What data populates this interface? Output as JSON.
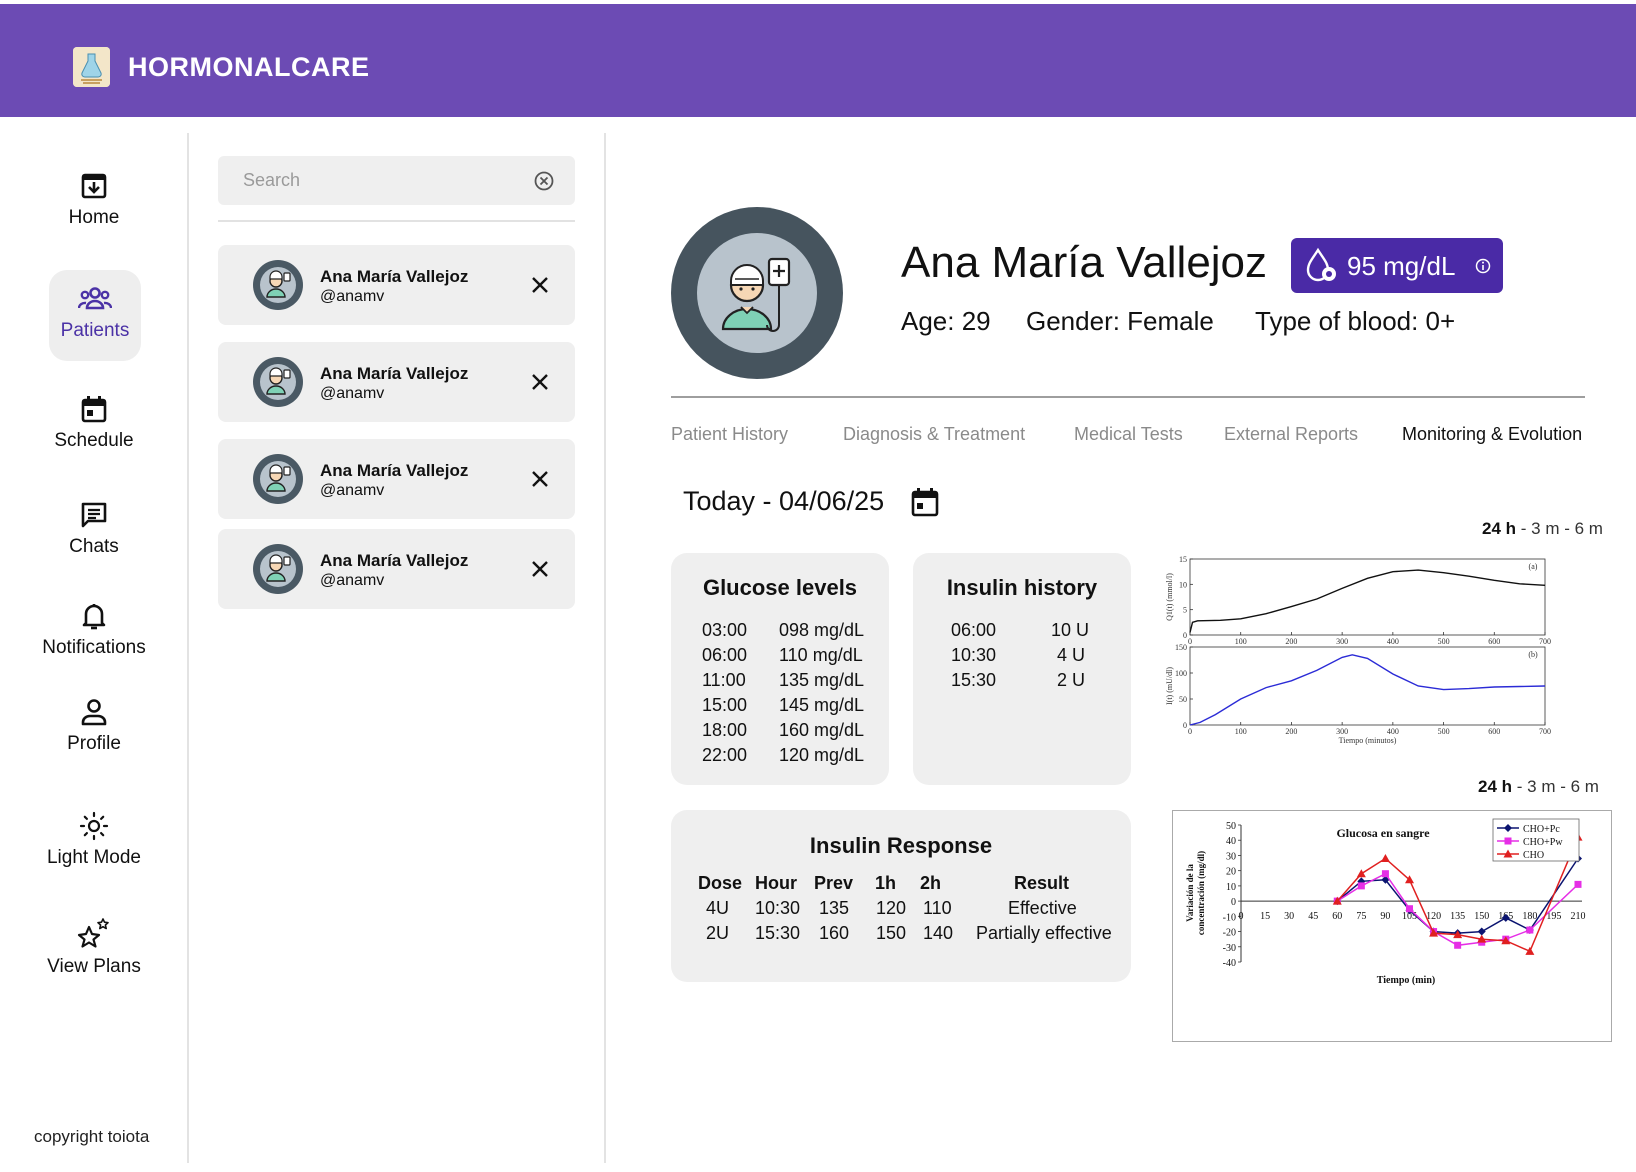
{
  "app": {
    "brand": "HORMONALCARE"
  },
  "nav": {
    "items": [
      {
        "label": "Home",
        "icon": "download-box-icon"
      },
      {
        "label": "Patients",
        "icon": "patients-group-icon",
        "active": true
      },
      {
        "label": "Schedule",
        "icon": "calendar-icon"
      },
      {
        "label": "Chats",
        "icon": "chat-icon"
      },
      {
        "label": "Notifications",
        "icon": "bell-icon"
      },
      {
        "label": "Profile",
        "icon": "user-icon"
      },
      {
        "label": "Light Mode",
        "icon": "sun-icon"
      },
      {
        "label": "View Plans",
        "icon": "stars-icon"
      }
    ],
    "copyright": "copyright toiota"
  },
  "search": {
    "placeholder": "Search",
    "value": ""
  },
  "patients_list": [
    {
      "name": "Ana María Vallejoz",
      "handle": "@anamv"
    },
    {
      "name": "Ana María Vallejoz",
      "handle": "@anamv"
    },
    {
      "name": "Ana María Vallejoz",
      "handle": "@anamv"
    },
    {
      "name": "Ana María Vallejoz",
      "handle": "@anamv"
    }
  ],
  "patient": {
    "name": "Ana María Vallejoz",
    "glucose_badge": "95 mg/dL",
    "age": "Age: 29",
    "gender": "Gender: Female",
    "blood": "Type of blood: 0+"
  },
  "tabs": [
    {
      "label": "Patient History",
      "active": false
    },
    {
      "label": "Diagnosis & Treatment",
      "active": false
    },
    {
      "label": "Medical Tests",
      "active": false
    },
    {
      "label": "External Reports",
      "active": false
    },
    {
      "label": "Monitoring & Evolution",
      "active": true
    }
  ],
  "date_label": "Today - 04/06/25",
  "glucose_levels": {
    "title": "Glucose levels",
    "rows": [
      {
        "time": "03:00",
        "value": "098 mg/dL"
      },
      {
        "time": "06:00",
        "value": "110 mg/dL"
      },
      {
        "time": "11:00",
        "value": "135 mg/dL"
      },
      {
        "time": "15:00",
        "value": "145 mg/dL"
      },
      {
        "time": "18:00",
        "value": "160 mg/dL"
      },
      {
        "time": "22:00",
        "value": "120 mg/dL"
      }
    ]
  },
  "insulin_history": {
    "title": "Insulin history",
    "rows": [
      {
        "time": "06:00",
        "dose": "10 U"
      },
      {
        "time": "10:30",
        "dose": "4 U"
      },
      {
        "time": "15:30",
        "dose": "2 U"
      }
    ]
  },
  "insulin_response": {
    "title": "Insulin Response",
    "headers": [
      "Dose",
      "Hour",
      "Prev",
      "1h",
      "2h",
      "Result"
    ],
    "rows": [
      [
        "4U",
        "10:30",
        "135",
        "120",
        "110",
        "Effective"
      ],
      [
        "2U",
        "15:30",
        "160",
        "150",
        "140",
        "Partially effective"
      ]
    ]
  },
  "range_selectors": [
    {
      "bold": "24 h",
      "rest": " - 3 m - 6 m"
    },
    {
      "bold": "24 h",
      "rest": " - 3 m - 6 m"
    }
  ],
  "chart_data": [
    {
      "type": "line",
      "panel_label": "(a)",
      "ylabel": "Q1(t) (mmol/l)",
      "xlim": [
        0,
        700
      ],
      "ylim": [
        0,
        15
      ],
      "xticks": [
        0,
        100,
        200,
        300,
        400,
        500,
        600,
        700
      ],
      "yticks": [
        0,
        5,
        10,
        15
      ],
      "series": [
        {
          "color": "#111111",
          "x": [
            0,
            5,
            15,
            60,
            100,
            150,
            200,
            250,
            300,
            350,
            400,
            450,
            500,
            550,
            600,
            650,
            700
          ],
          "y": [
            0.5,
            2.5,
            2.8,
            2.9,
            3.2,
            4.2,
            5.6,
            7.1,
            9.2,
            11.2,
            12.5,
            12.8,
            12.3,
            11.6,
            10.8,
            10.1,
            9.8
          ]
        }
      ]
    },
    {
      "type": "line",
      "panel_label": "(b)",
      "ylabel": "I(t) (mU/dl)",
      "xlabel": "Tiempo (minutos)",
      "xlim": [
        0,
        700
      ],
      "ylim": [
        0,
        150
      ],
      "xticks": [
        0,
        100,
        200,
        300,
        400,
        500,
        600,
        700
      ],
      "yticks": [
        0,
        50,
        100,
        150
      ],
      "series": [
        {
          "color": "#2b2bd6",
          "x": [
            0,
            20,
            50,
            100,
            150,
            200,
            250,
            300,
            320,
            350,
            400,
            450,
            500,
            550,
            600,
            650,
            700
          ],
          "y": [
            0,
            5,
            20,
            50,
            72,
            85,
            105,
            130,
            135,
            128,
            98,
            75,
            68,
            70,
            73,
            74,
            75
          ]
        }
      ]
    },
    {
      "type": "line",
      "title": "Glucosa en sangre",
      "xlabel": "Tiempo (min)",
      "ylabel": "Variación de la concentración (mg/dl)",
      "categories": [
        "0",
        "15",
        "30",
        "45",
        "60",
        "75",
        "90",
        "105",
        "120",
        "135",
        "150",
        "165",
        "180",
        "195",
        "210"
      ],
      "ylim": [
        -40,
        50
      ],
      "yticks": [
        50,
        40,
        30,
        20,
        10,
        0,
        -10,
        -20,
        -30,
        -40
      ],
      "legend_position": "top-right",
      "series": [
        {
          "name": "CHO+Pc",
          "color": "#0b1470",
          "marker": "diamond",
          "points": [
            [
              60,
              0
            ],
            [
              75,
              13
            ],
            [
              90,
              14
            ],
            [
              105,
              -6
            ],
            [
              120,
              -20
            ],
            [
              135,
              -21
            ],
            [
              150,
              -20
            ],
            [
              165,
              -11
            ],
            [
              180,
              -19
            ],
            [
              210,
              28
            ]
          ]
        },
        {
          "name": "CHO+Pw",
          "color": "#e62ee6",
          "marker": "square",
          "points": [
            [
              60,
              0
            ],
            [
              75,
              10
            ],
            [
              90,
              18
            ],
            [
              105,
              -5
            ],
            [
              120,
              -20
            ],
            [
              135,
              -29
            ],
            [
              150,
              -27
            ],
            [
              165,
              -25
            ],
            [
              180,
              -19
            ],
            [
              210,
              11
            ]
          ]
        },
        {
          "name": "CHO",
          "color": "#e02020",
          "marker": "triangle",
          "points": [
            [
              60,
              0
            ],
            [
              75,
              18
            ],
            [
              90,
              28
            ],
            [
              105,
              14
            ],
            [
              120,
              -21
            ],
            [
              135,
              -22
            ],
            [
              150,
              -25
            ],
            [
              165,
              -26
            ],
            [
              180,
              -33
            ],
            [
              210,
              42
            ]
          ]
        }
      ]
    }
  ]
}
